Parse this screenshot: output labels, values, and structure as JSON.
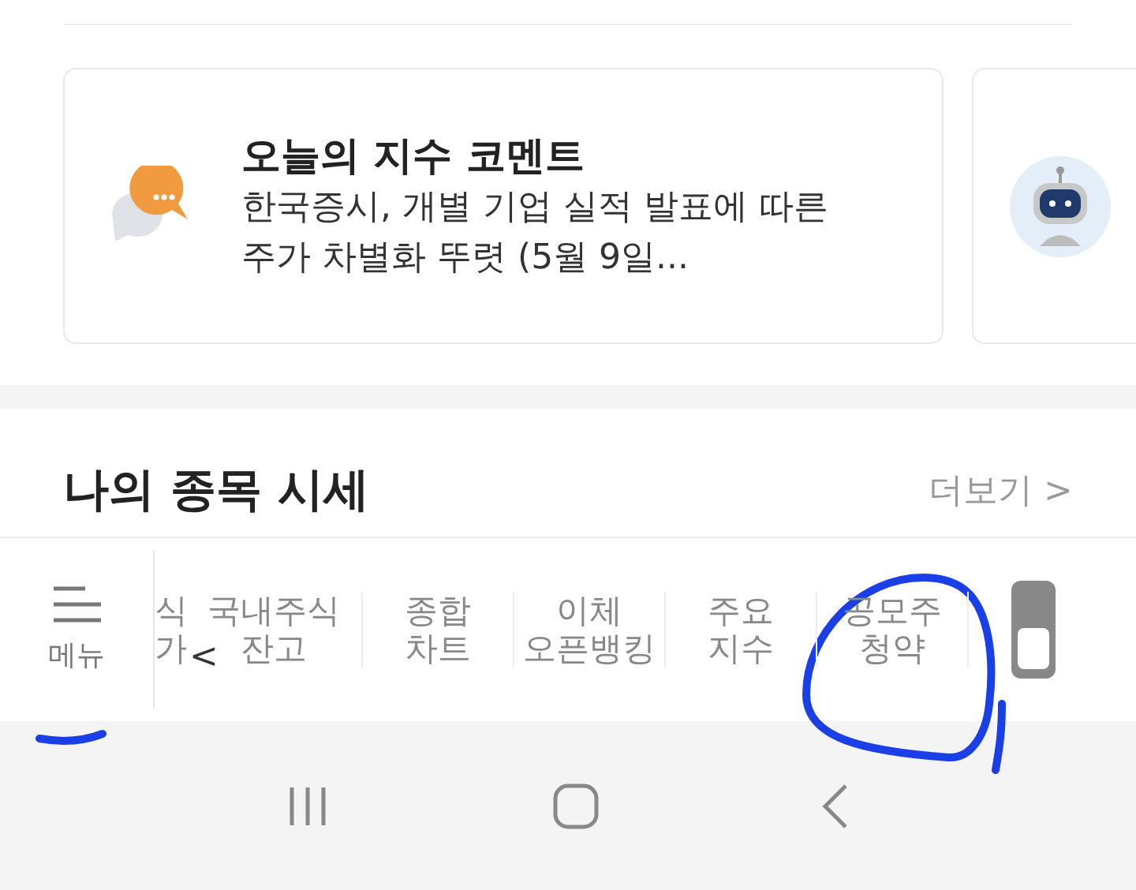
{
  "comment_card": {
    "title": "오늘의 지수 코멘트",
    "body": "한국증시, 개별 기업 실적 발표에 따른 주가 차별화 뚜렷 (5월 9일..."
  },
  "section": {
    "title": "나의 종목 시세",
    "more": "더보기 >"
  },
  "menu_bar": {
    "menu_label": "메뉴",
    "scroll_left": "<",
    "items": [
      {
        "lines": [
          "식",
          "가"
        ],
        "kind": "cut"
      },
      {
        "lines": [
          "국내주식",
          "잔고"
        ],
        "kind": "full"
      },
      {
        "lines": [
          "종합",
          "차트"
        ],
        "kind": "full"
      },
      {
        "lines": [
          "이체",
          "오픈뱅킹"
        ],
        "kind": "full"
      },
      {
        "lines": [
          "주요",
          "지수"
        ],
        "kind": "full"
      },
      {
        "lines": [
          "공모주",
          "청약"
        ],
        "kind": "full"
      }
    ]
  }
}
